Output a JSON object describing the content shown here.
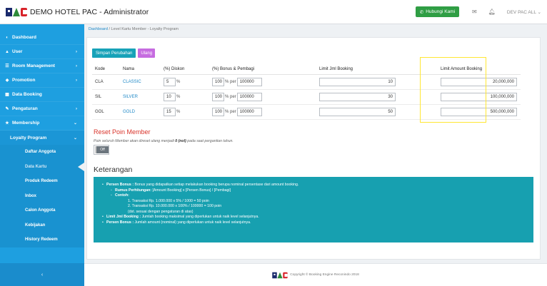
{
  "header": {
    "title": "DEMO HOTEL PAC - Administrator",
    "hubungi_label": "Hubungi Kami",
    "user_label": "DEV PAC ALL"
  },
  "sidebar": {
    "items": [
      {
        "label": "Dashboard"
      },
      {
        "label": "User"
      },
      {
        "label": "Room Management"
      },
      {
        "label": "Promotion"
      },
      {
        "label": "Data Booking"
      },
      {
        "label": "Pengaturan"
      },
      {
        "label": "Membership"
      }
    ],
    "loyalty": "Loyalty Program",
    "subitems": [
      {
        "label": "Daftar Anggota"
      },
      {
        "label": "Data Kartu"
      },
      {
        "label": "Produk Redeem"
      },
      {
        "label": "Inbox"
      },
      {
        "label": "Calon Anggota"
      },
      {
        "label": "Kebijakan"
      },
      {
        "label": "History Redeem"
      }
    ]
  },
  "breadcrumb": {
    "home": "Dashboard",
    "sep": " / ",
    "current": "Level Kartu Member - Loyalty Program"
  },
  "actions": {
    "save_label": "Simpan Perubahan",
    "reset_label": "Ulang"
  },
  "table": {
    "headers": [
      "Kode",
      "Nama",
      "(%) Diskon",
      "(%) Bonus & Pembagi",
      "Limit Jml Booking",
      "Limit Amount Booking"
    ],
    "percent_unit": "%",
    "per_unit": "% per",
    "rows": [
      {
        "kode": "CLA",
        "nama": "CLASSIC",
        "diskon": "5",
        "bonus": "100",
        "pembagi": "100000",
        "limit_jml": "10",
        "limit_amount": "20,000,000"
      },
      {
        "kode": "SIL",
        "nama": "SILVER",
        "diskon": "10",
        "bonus": "100",
        "pembagi": "100000",
        "limit_jml": "30",
        "limit_amount": "100,000,000"
      },
      {
        "kode": "GOL",
        "nama": "GOLD",
        "diskon": "15",
        "bonus": "100",
        "pembagi": "100000",
        "limit_jml": "50",
        "limit_amount": "500,000,000"
      }
    ]
  },
  "reset": {
    "title": "Reset Poin Member",
    "desc_pre": "Poin seluruh Member akan direset ulang menjadi ",
    "desc_bold": "0 (nol)",
    "desc_post": " pada saat pergantian tahun.",
    "toggle_label": "Off"
  },
  "keterangan": {
    "title": "Keterangan",
    "lines": [
      {
        "bold": "Persen Bonus :",
        "text": " Bonus yang didapatkan setiap melakukan booking berupa nominal persentase dari amount booking."
      },
      {
        "bold": "Rumus Perhitungan:",
        "text": " [Amount Booking] x [Persen Bonus] / [Pembagi]"
      },
      {
        "bold": "Contoh:",
        "text": ""
      },
      {
        "bold": "",
        "text": "1. Transaksi Rp. 1.000.000 x 5% / 1000 = 50 poin"
      },
      {
        "bold": "",
        "text": "2. Transaksi Rp. 10.000.000 x 100% / 100000 = 100 poin"
      },
      {
        "bold": "",
        "text": "(dst. sesuai dengan pengaturan di atas)"
      },
      {
        "bold": "Limit Jml Booking :",
        "text": " Jumlah booking maksimal yang diperlukan untuk naik level selanjutnya."
      },
      {
        "bold": "Persen Bonus :",
        "text": " Jumlah amount (nominal) yang diperlukan untuk naik level selanjutnya."
      }
    ]
  },
  "footer": {
    "text": "Copyright © Booking Engine Reconindo 2018"
  },
  "colors": {
    "sidebar": "#1e9fe0",
    "accent_teal": "#17a0b0",
    "reset_red": "#d9342b",
    "highlight": "#ffe733"
  }
}
